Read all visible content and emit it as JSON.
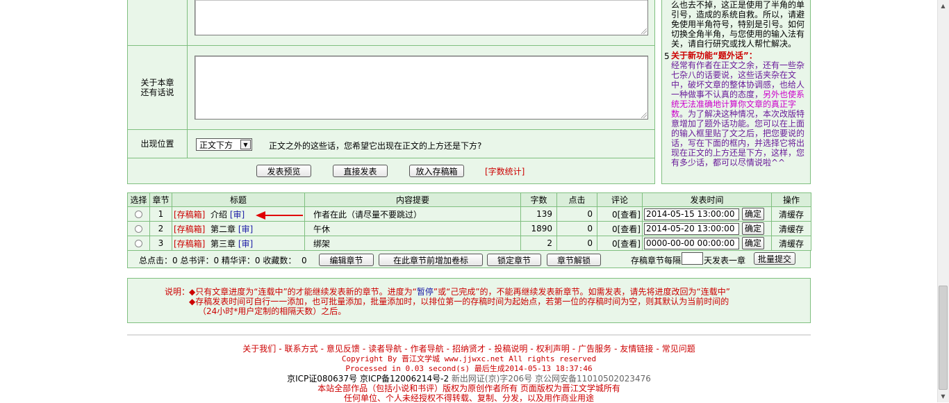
{
  "editor": {
    "note_label": "关于本章\n还有话说",
    "position_label": "出现位置",
    "position_selected": "正文下方",
    "position_question": "正文之外的这些话，您希望它出现在正文的上方还是下方?",
    "buttons": {
      "preview": "发表预览",
      "publish": "直接发表",
      "save_draft": "放入存稿箱",
      "word_count": "[字数统计]"
    }
  },
  "help": {
    "item4_tail": "么也去不掉，这正是使用了半角的单引号，造成的系统自救。所以，请避免使用半角符号，特别是引号。如何切换全角半角，与您使用的输入法有关，请自行研究或找人帮忙解决。",
    "item5_num": "5",
    "item5_title": "关于新功能“题外话”：",
    "item5_body_1": "经常有作者在正文之余，还有一些杂七杂八的话要说，这些话夹杂在文中，破坏文章的整体协调感，也给人一种做事不认真的态度，",
    "item5_body_2": "另外也使系统无法准确地计算你文章的真正字数",
    "item5_body_3": "。为了解决这种情况，本次改版特意增加了题外话功能。您可以在上面的输入框里贴了文之后，把您要说的话，写在下面的框内，并选择它将出现在正文的上方还是下方，这样，您有多少话，都可以尽情说啦^^",
    "colors": {
      "body": "#6a1b9a",
      "highlight": "#cc00cc",
      "title": "#cc0000"
    }
  },
  "table": {
    "headers": [
      "选择",
      "章节",
      "标题",
      "内容提要",
      "字数",
      "点击",
      "评论",
      "发表时间",
      "操作"
    ],
    "rows": [
      {
        "num": "1",
        "box": "[存稿箱]",
        "title": "介绍",
        "audit": "[审]",
        "summary": "作者在此（请尽量不要跳过）",
        "words": "139",
        "clicks": "0",
        "comments": "0",
        "view": "[查看]",
        "time": "2014-05-15 13:00:00",
        "confirm": "确定",
        "action": "清缓存"
      },
      {
        "num": "2",
        "box": "[存稿箱]",
        "title": "第二章",
        "audit": "[审]",
        "summary": "午休",
        "words": "1890",
        "clicks": "0",
        "comments": "0",
        "view": "[查看]",
        "time": "2014-05-20 13:00:00",
        "confirm": "确定",
        "action": "清缓存"
      },
      {
        "num": "3",
        "box": "[存稿箱]",
        "title": "第三章",
        "audit": "[审]",
        "summary": "绑架",
        "words": "2",
        "clicks": "0",
        "comments": "0",
        "view": "[查看]",
        "time": "0000-00-00 00:00:00",
        "confirm": "确定",
        "action": "清缓存"
      }
    ]
  },
  "stats": {
    "text": "总点击：0 总书评：0 精华评：0 收藏数：  0",
    "btn_edit": "编辑章节",
    "btn_add_volume": "在此章节前增加卷标",
    "btn_lock": "锁定章节",
    "btn_unlock": "章节解锁",
    "interval_before": "存稿章节每隔",
    "interval_after": "天发表一章",
    "btn_batch": "批量提交"
  },
  "notes": {
    "label": "说明：",
    "line1_a": "◆只有文章进度为“连载中”的才能继续发表新的章节。进度为“",
    "line1_pause": "暂停",
    "line1_b": "”或“己完成”的，不能再继续发表新章节。如需发表，请先将进度改回为“连载中”",
    "line2": "◆存稿发表时间可自行一一添加，也可批量添加，批量添加时，以排位第一的存稿时间为起始点，若第一位的存稿时间为空，则其默认为当前时间的",
    "line3": "（24小时*用户定制的相隔天数）之后。",
    "pause_color": "#1a1aa6"
  },
  "footer": {
    "links": [
      "关于我们",
      "联系方式",
      "意见反馈",
      "读者导航",
      "作者导航",
      "招纳贤才",
      "投稿说明",
      "权利声明",
      "广告服务",
      "友情链接",
      "常见问题"
    ],
    "separator": "-",
    "copyright": "Copyright By 晋江文学城 www.jjwxc.net All rights reserved",
    "processed": "Processed in 0.03 second(s) 最后生成2014-05-13 18:37:46",
    "icp": "京ICP证080637号 京ICP备12006214号-2 ",
    "license": "新出网证(京)字206号 京公网安备11010502023476",
    "rights1": "本站全部作品（包括小说和书评）版权为原创作者所有  页面版权为晋江文学城所有",
    "rights2": "任何单位、个人未经授权不得转载、复制、分发，以及用作商业用途"
  }
}
